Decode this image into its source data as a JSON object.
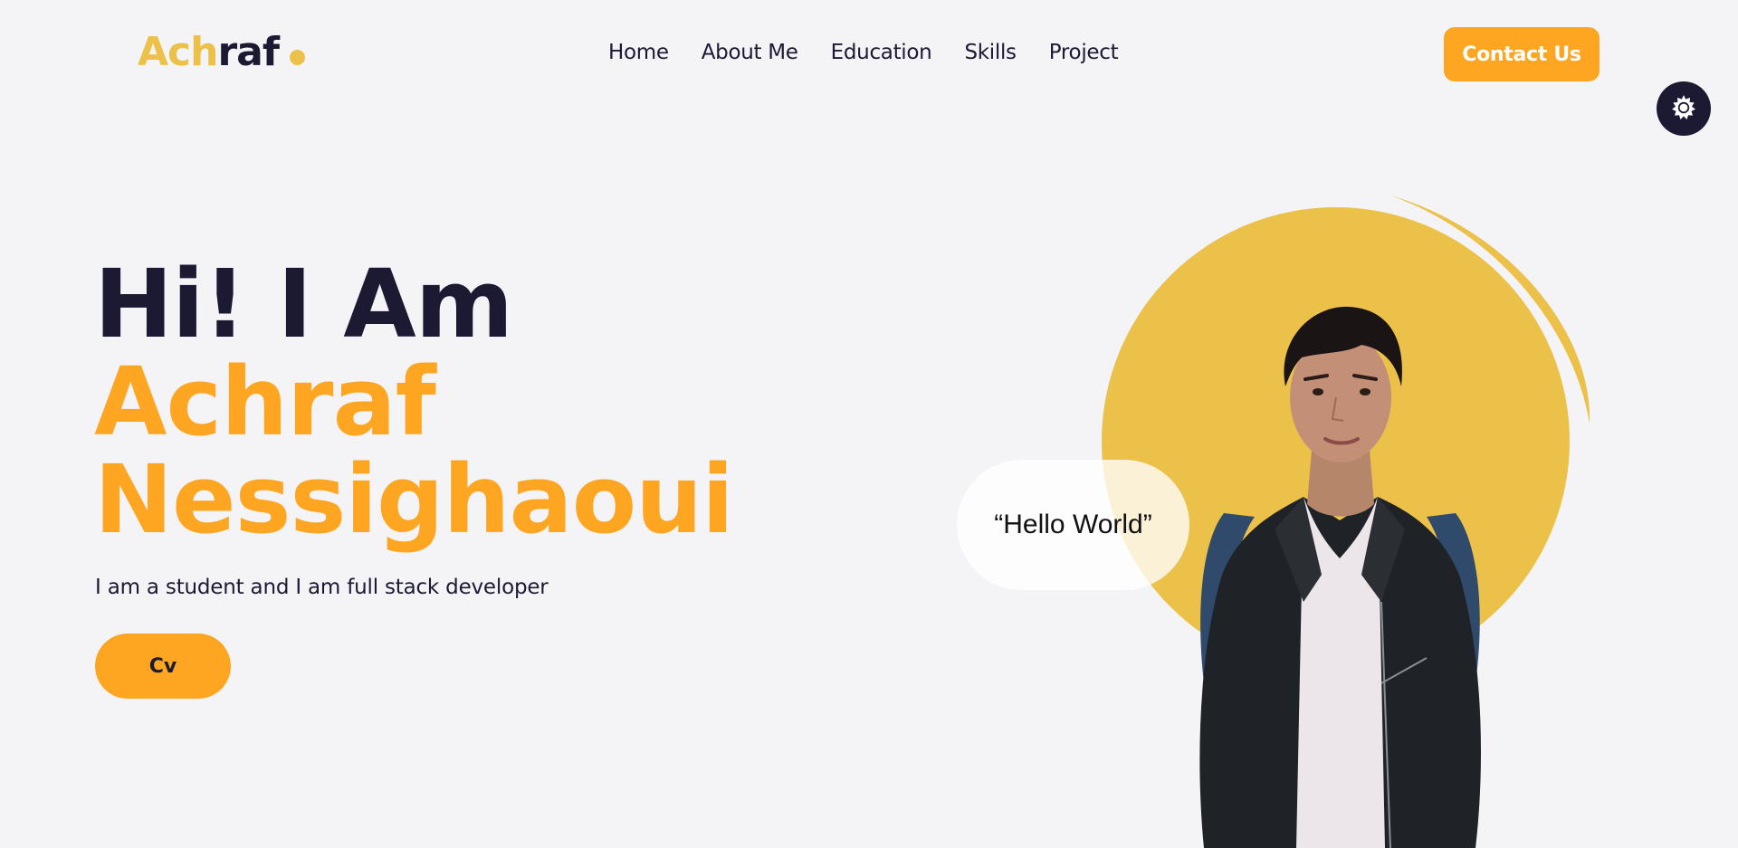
{
  "header": {
    "logo": {
      "part_accent": "Ach",
      "part_dark": "raf"
    },
    "nav": [
      "Home",
      "About Me",
      "Education",
      "Skills",
      "Project"
    ],
    "contact_label": "Contact Us",
    "theme_toggle_icon": "sun-icon"
  },
  "hero": {
    "line1": "Hi! I Am",
    "line2": "Achraf",
    "line3": "Nessighaoui",
    "tagline": "I am a student and I am full stack developer",
    "cv_label": "Cv",
    "bubble_text": "“Hello World”"
  },
  "colors": {
    "accent": "#fea621",
    "circle": "#ecc14a",
    "dark": "#1c1a33",
    "background": "#f4f4f7"
  }
}
